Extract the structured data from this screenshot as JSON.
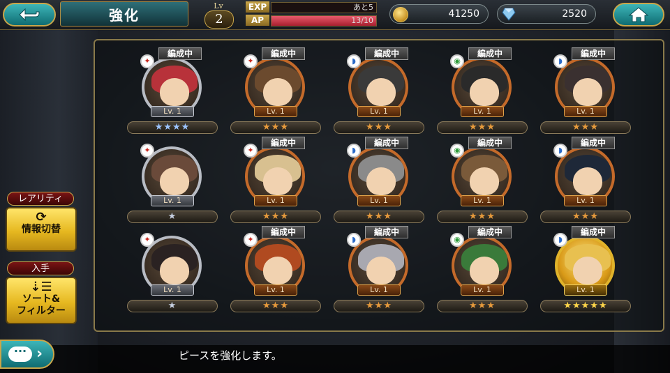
{
  "header": {
    "title": "強化",
    "level_label": "Lv",
    "level_value": "2",
    "exp_label": "EXP",
    "exp_text": "あと5",
    "exp_fraction": 0.0,
    "ap_label": "AP",
    "ap_text": "13/10",
    "ap_fraction": 1.0,
    "coins": "41250",
    "gems": "2520"
  },
  "left_panel": {
    "rarity_tag": "レアリティ",
    "info_button": {
      "icon": "cycle-icon",
      "label": "情報切替"
    },
    "acquire_tag": "入手",
    "sort_button": {
      "icon": "sort-icon",
      "label_line1": "ソート&",
      "label_line2": "フィルター"
    }
  },
  "status_text": "編成中",
  "units": [
    {
      "level": "Lv. 1",
      "status": true,
      "stars": "★★★★",
      "rank": "blue",
      "element": "fire",
      "frame": "silver",
      "hair": "#b8323a"
    },
    {
      "level": "Lv. 1",
      "status": true,
      "stars": "★★★",
      "rank": "bronze",
      "element": "fire",
      "frame": "bronze",
      "hair": "#6b4a2e"
    },
    {
      "level": "Lv. 1",
      "status": true,
      "stars": "★★★",
      "rank": "bronze",
      "element": "water",
      "frame": "bronze",
      "hair": "#3a3a3a"
    },
    {
      "level": "Lv. 1",
      "status": true,
      "stars": "★★★",
      "rank": "bronze",
      "element": "wind",
      "frame": "bronze",
      "hair": "#2a2a2a"
    },
    {
      "level": "Lv. 1",
      "status": true,
      "stars": "★★★",
      "rank": "bronze",
      "element": "water",
      "frame": "bronze",
      "hair": "#3a3030"
    },
    {
      "level": "Lv. 1",
      "status": false,
      "stars": "★",
      "rank": "silver",
      "element": "fire",
      "frame": "silver",
      "hair": "#6a4a3a"
    },
    {
      "level": "Lv. 1",
      "status": true,
      "stars": "★★★",
      "rank": "bronze",
      "element": "fire",
      "frame": "bronze",
      "hair": "#d8c090"
    },
    {
      "level": "Lv. 1",
      "status": true,
      "stars": "★★★",
      "rank": "bronze",
      "element": "water",
      "frame": "bronze",
      "hair": "#8a8a8a"
    },
    {
      "level": "Lv. 1",
      "status": true,
      "stars": "★★★",
      "rank": "bronze",
      "element": "wind",
      "frame": "bronze",
      "hair": "#7a5a3a"
    },
    {
      "level": "Lv. 1",
      "status": true,
      "stars": "★★★",
      "rank": "bronze",
      "element": "water",
      "frame": "bronze",
      "hair": "#1e2838"
    },
    {
      "level": "Lv. 1",
      "status": false,
      "stars": "★",
      "rank": "silver",
      "element": "fire",
      "frame": "silver",
      "hair": "#2a2222"
    },
    {
      "level": "Lv. 1",
      "status": true,
      "stars": "★★★",
      "rank": "bronze",
      "element": "fire",
      "frame": "bronze",
      "hair": "#b04a20"
    },
    {
      "level": "Lv. 1",
      "status": true,
      "stars": "★★★",
      "rank": "bronze",
      "element": "water",
      "frame": "bronze",
      "hair": "#a8a8b0"
    },
    {
      "level": "Lv. 1",
      "status": true,
      "stars": "★★★",
      "rank": "bronze",
      "element": "wind",
      "frame": "bronze",
      "hair": "#3a7a3a"
    },
    {
      "level": "Lv. 1",
      "status": true,
      "stars": "★★★★★",
      "rank": "gold",
      "element": "water",
      "frame": "gold",
      "hair": "#e8c050"
    }
  ],
  "message": "ピースを強化します。"
}
